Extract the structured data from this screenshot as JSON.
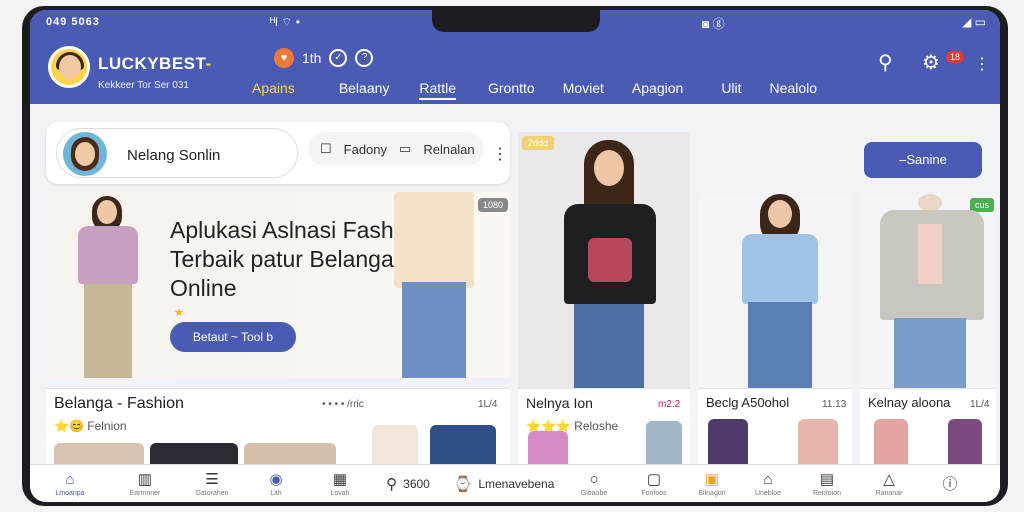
{
  "status": {
    "time": "049 5063",
    "mid_icons": "ᴴl ⌔  •",
    "right_icons": "◙ ⓖ",
    "far_icons": "◢ ▭"
  },
  "header": {
    "brand_main": "LUCKYBEST",
    "brand_suffix": "-",
    "subtitle": "Kekkeer Tor Ser 031",
    "icon_text": "1th",
    "nav": [
      {
        "label": "Apains",
        "state": "active"
      },
      {
        "label": "Belaany",
        "state": ""
      },
      {
        "label": "Rattle",
        "state": "current"
      },
      {
        "label": "Grontto",
        "state": ""
      },
      {
        "label": "Moviet",
        "state": ""
      },
      {
        "label": "Apagion",
        "state": ""
      },
      {
        "label": "Ulit",
        "state": ""
      },
      {
        "label": "Nealolo",
        "state": ""
      }
    ],
    "badge": "18"
  },
  "profile": {
    "name": "Nelang Sonlin",
    "action1": "Fadony",
    "action2": "Relnalan"
  },
  "hero": {
    "title": "Aplukasi Aslnasi Fashion Terbaik patur Belanga Online",
    "button": "Betaut ~ Tool b",
    "tag": "1080"
  },
  "side": {
    "big_tag": "2ddd",
    "search_btn": "–Sanine",
    "green_tag": "cus"
  },
  "rows": [
    {
      "title": "Belanga - Fashion",
      "meta": "• • • • /rric",
      "meta2": "1L/4",
      "sub": "Felnion",
      "stars": "⭐😊"
    },
    {
      "title": "Nelnya Ion",
      "meta": "m2:2",
      "meta2": "",
      "sub": "Reloshe",
      "stars": "⭐⭐⭐"
    },
    {
      "title": "Beclg A50ohol",
      "meta": "11.13",
      "meta2": "",
      "sub": "",
      "stars": ""
    },
    {
      "title": "Kelnay aloona",
      "meta": "1L/4",
      "meta2": "",
      "sub": "",
      "stars": ""
    }
  ],
  "bottom_tabs": [
    {
      "icon": "home-icon",
      "glyph": "⌂",
      "label": "Lmoanpa",
      "active": true
    },
    {
      "icon": "chart-icon",
      "glyph": "▥",
      "label": "Earmnner"
    },
    {
      "icon": "bag-icon",
      "glyph": "☰",
      "label": "Gatorahen"
    },
    {
      "icon": "play-icon",
      "glyph": "◉",
      "label": "Lith"
    },
    {
      "icon": "grid-icon",
      "glyph": "▦",
      "label": "Lovah"
    },
    {
      "icon": "search-icon",
      "glyph": "⚲",
      "label": "3600",
      "inline": true
    },
    {
      "icon": "clock-icon",
      "glyph": "⌚",
      "label": "Lmenavebena",
      "inline": true
    },
    {
      "icon": "chat-icon",
      "glyph": "○",
      "label": "Gloaobe"
    },
    {
      "icon": "book-icon",
      "glyph": "▢",
      "label": "Fonfoos"
    },
    {
      "icon": "box-icon",
      "glyph": "▣",
      "label": "Bllnagon"
    },
    {
      "icon": "cart-icon",
      "glyph": "⌂",
      "label": "Unebloe"
    },
    {
      "icon": "doc-icon",
      "glyph": "▤",
      "label": "Rentoion"
    },
    {
      "icon": "bell-icon",
      "glyph": "△",
      "label": "Rananar"
    },
    {
      "icon": "info-icon",
      "glyph": "ⓘ",
      "label": ""
    }
  ]
}
